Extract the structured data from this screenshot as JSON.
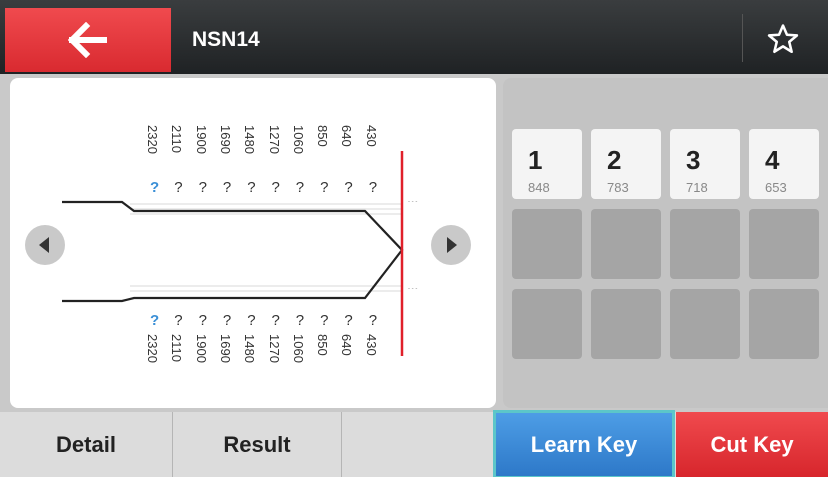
{
  "header": {
    "back_icon": "arrow-left-icon",
    "title": "NSN14",
    "favorite_icon": "star-outline-icon"
  },
  "key": {
    "depths_top": [
      "2320",
      "2110",
      "1900",
      "1690",
      "1480",
      "1270",
      "1060",
      "850",
      "640",
      "430"
    ],
    "depths_bottom": [
      "2320",
      "2110",
      "1900",
      "1690",
      "1480",
      "1270",
      "1060",
      "850",
      "640",
      "430"
    ],
    "cuts_top": [
      "?",
      "?",
      "?",
      "?",
      "?",
      "?",
      "?",
      "?",
      "?",
      "?"
    ],
    "cuts_bottom": [
      "?",
      "?",
      "?",
      "?",
      "?",
      "?",
      "?",
      "?",
      "?",
      "?"
    ],
    "prev_icon": "triangle-left-icon",
    "next_icon": "triangle-right-icon",
    "highlight_color": "#3a8fd6",
    "tip_line_color": "#e0202a"
  },
  "results": {
    "tiles": [
      {
        "num": "1",
        "value": "848"
      },
      {
        "num": "2",
        "value": "783"
      },
      {
        "num": "3",
        "value": "718"
      },
      {
        "num": "4",
        "value": "653"
      }
    ],
    "empty_rows": 2
  },
  "bottom": {
    "detail": "Detail",
    "result": "Result",
    "learn_key": "Learn Key",
    "cut_key": "Cut Key"
  }
}
